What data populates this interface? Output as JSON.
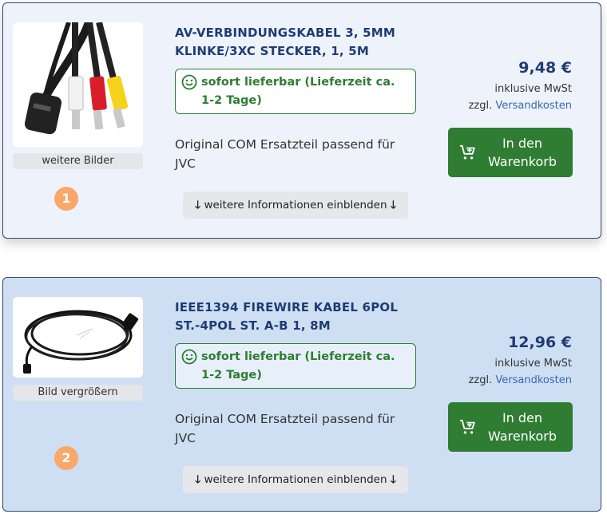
{
  "products": [
    {
      "title": "AV-VERBINDUNGSKABEL 3, 5MM KLINKE/3XC STECKER, 1, 5M",
      "image_button": "weitere Bilder",
      "number": "1",
      "availability": "sofort lieferbar (Lieferzeit ca. 1-2 Tage)",
      "description": "Original COM Ersatzteil passend für JVC",
      "more_info": "weitere Informationen einblenden",
      "price": "9,48 €",
      "vat": "inklusive MwSt",
      "shipping_prefix": "zzgl.",
      "shipping_link": "Versandkosten",
      "cart_button": "In den Warenkorb"
    },
    {
      "title": "IEEE1394 FIREWIRE KABEL 6POL ST.-4POL ST. A-B 1, 8M",
      "image_button": "Bild vergrößern",
      "number": "2",
      "availability": "sofort lieferbar (Lieferzeit ca. 1-2 Tage)",
      "description": "Original COM Ersatzteil passend für JVC",
      "more_info": "weitere Informationen einblenden",
      "price": "12,96 €",
      "vat": "inklusive MwSt",
      "shipping_prefix": "zzgl.",
      "shipping_link": "Versandkosten",
      "cart_button": "In den Warenkorb"
    }
  ],
  "icons": {
    "availability": "smiley-icon",
    "cart": "cart-add-icon",
    "more_info": "arrow-down-icon"
  },
  "colors": {
    "title": "#1f3c74",
    "available_green": "#2e7d32",
    "card1_bg": "#eef3fb",
    "card2_bg": "#cfdff3",
    "badge": "#f9a86a",
    "link": "#3568b3"
  }
}
